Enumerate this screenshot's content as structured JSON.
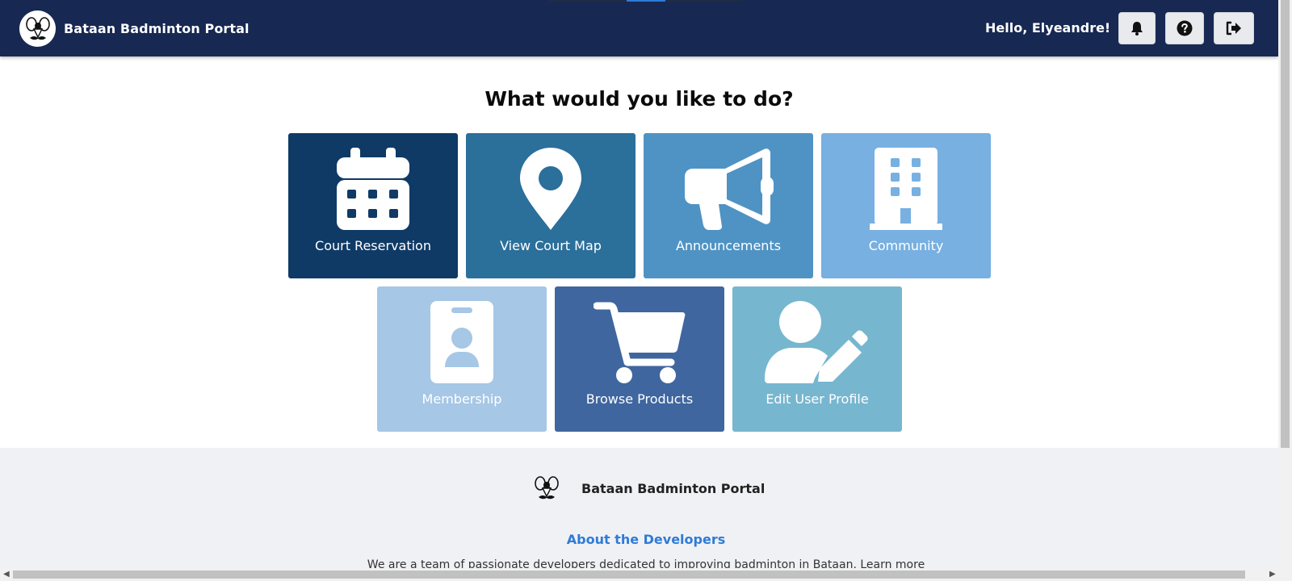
{
  "header": {
    "title": "Bataan Badminton Portal",
    "greeting": "Hello, Elyeandre!",
    "buttons": [
      {
        "icon": "bell-icon"
      },
      {
        "icon": "question-circle-icon"
      },
      {
        "icon": "logout-icon"
      }
    ]
  },
  "main": {
    "title": "What would you like to do?",
    "tiles": [
      {
        "label": "Court Reservation",
        "icon": "calendar-icon",
        "color": "#0f3a66"
      },
      {
        "label": "View Court Map",
        "icon": "map-pin-icon",
        "color": "#2b6f9b"
      },
      {
        "label": "Announcements",
        "icon": "megaphone-icon",
        "color": "#4f93c4"
      },
      {
        "label": "Community",
        "icon": "building-icon",
        "color": "#77b0e1"
      },
      {
        "label": "Membership",
        "icon": "id-badge-icon",
        "color": "#a6c7e5"
      },
      {
        "label": "Browse Products",
        "icon": "shopping-cart-icon",
        "color": "#3f669f"
      },
      {
        "label": "Edit User Profile",
        "icon": "user-edit-icon",
        "color": "#77b6cf"
      }
    ]
  },
  "footer": {
    "title": "Bataan Badminton Portal",
    "about_title": "About the Developers",
    "about_text": "We are a team of passionate developers dedicated to improving badminton in Bataan. Learn more"
  }
}
